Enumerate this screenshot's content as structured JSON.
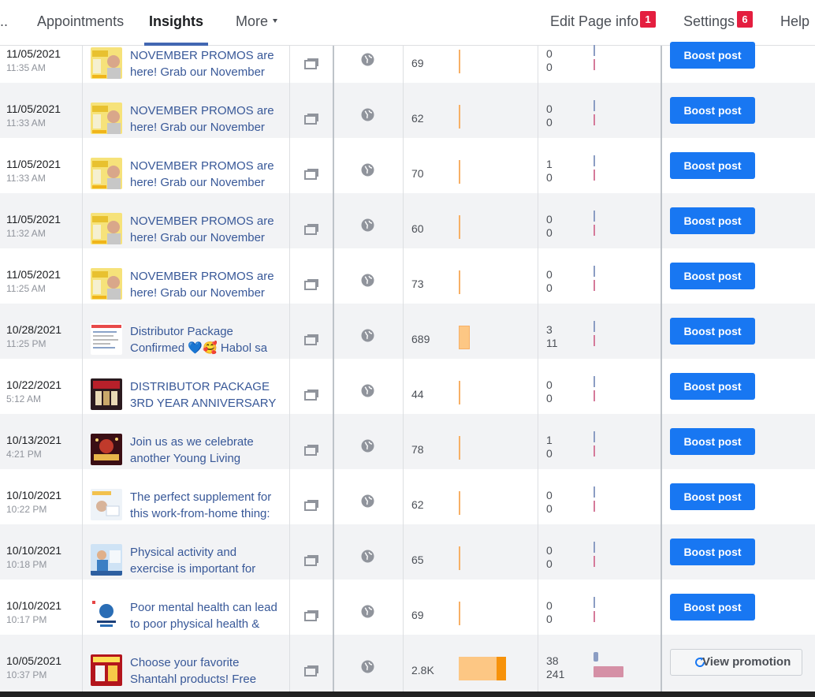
{
  "nav": {
    "leading": "..",
    "appointments": "Appointments",
    "insights": "Insights",
    "more": "More",
    "edit_page_info": "Edit Page info",
    "edit_badge": "1",
    "settings": "Settings",
    "settings_badge": "6",
    "help": "Help"
  },
  "boost_label": "Boost post",
  "view_promotion_label": "View promotion",
  "posts": [
    {
      "date": "11/05/2021",
      "time": "11:35 AM",
      "line1": "NOVEMBER PROMOS are",
      "line2": "here! Grab our November",
      "reach": "69",
      "eng1": "0",
      "eng2": "0",
      "action": "boost",
      "thumb": "promo-yellow"
    },
    {
      "date": "11/05/2021",
      "time": "11:33 AM",
      "line1": "NOVEMBER PROMOS are",
      "line2": "here! Grab our November",
      "reach": "62",
      "eng1": "0",
      "eng2": "0",
      "action": "boost",
      "thumb": "promo-yellow"
    },
    {
      "date": "11/05/2021",
      "time": "11:33 AM",
      "line1": "NOVEMBER PROMOS are",
      "line2": "here! Grab our November",
      "reach": "70",
      "eng1": "1",
      "eng2": "0",
      "action": "boost",
      "thumb": "promo-yellow"
    },
    {
      "date": "11/05/2021",
      "time": "11:32 AM",
      "line1": "NOVEMBER PROMOS are",
      "line2": "here! Grab our November",
      "reach": "60",
      "eng1": "0",
      "eng2": "0",
      "action": "boost",
      "thumb": "promo-yellow"
    },
    {
      "date": "11/05/2021",
      "time": "11:25 AM",
      "line1": "NOVEMBER PROMOS are",
      "line2": "here! Grab our November",
      "reach": "73",
      "eng1": "0",
      "eng2": "0",
      "action": "boost",
      "thumb": "promo-yellow"
    },
    {
      "date": "10/28/2021",
      "time": "11:25 PM",
      "line1": "Distributor Package",
      "line2": "Confirmed 💙🥰 Habol sa",
      "reach": "689",
      "eng1": "3",
      "eng2": "11",
      "action": "boost",
      "thumb": "document"
    },
    {
      "date": "10/22/2021",
      "time": "5:12 AM",
      "line1": "DISTRIBUTOR PACKAGE",
      "line2": "3RD YEAR ANNIVERSARY",
      "reach": "44",
      "eng1": "0",
      "eng2": "0",
      "action": "boost",
      "thumb": "anniversary"
    },
    {
      "date": "10/13/2021",
      "time": "4:21 PM",
      "line1": "Join us as we celebrate",
      "line2": "another Young Living",
      "reach": "78",
      "eng1": "1",
      "eng2": "0",
      "action": "boost",
      "thumb": "celebration"
    },
    {
      "date": "10/10/2021",
      "time": "10:22 PM",
      "line1": "The perfect supplement for",
      "line2": "this work-from-home thing:",
      "reach": "62",
      "eng1": "0",
      "eng2": "0",
      "action": "boost",
      "thumb": "wfh"
    },
    {
      "date": "10/10/2021",
      "time": "10:18 PM",
      "line1": "Physical activity and",
      "line2": "exercise is important for",
      "reach": "65",
      "eng1": "0",
      "eng2": "0",
      "action": "boost",
      "thumb": "exercise"
    },
    {
      "date": "10/10/2021",
      "time": "10:17 PM",
      "line1": "Poor mental health can lead",
      "line2": "to poor physical health &",
      "reach": "69",
      "eng1": "0",
      "eng2": "0",
      "action": "boost",
      "thumb": "mental"
    },
    {
      "date": "10/05/2021",
      "time": "10:37 PM",
      "line1": "Choose your favorite",
      "line2": "Shantahl products! Free",
      "reach": "2.8K",
      "eng1": "38",
      "eng2": "241",
      "action": "view",
      "thumb": "redhot"
    }
  ],
  "bars": {
    "reach_fill": [
      0.03,
      0.03,
      0.03,
      0.03,
      0.03,
      0.34,
      0.03,
      0.03,
      0.03,
      0.03,
      0.03,
      1.0
    ],
    "eng1_fill": [
      0.0,
      0.0,
      0.03,
      0.0,
      0.0,
      0.08,
      0.0,
      0.03,
      0.0,
      0.0,
      0.0,
      1.0
    ],
    "eng2_fill": [
      0.0,
      0.0,
      0.0,
      0.0,
      0.0,
      0.05,
      0.0,
      0.0,
      0.0,
      0.0,
      0.0,
      1.0
    ]
  },
  "colors": {
    "accent": "#1877f2",
    "reach_bar": "#f7923a",
    "eng_bar_a": "#8b9dc3",
    "eng_bar_b": "#d57a9a",
    "link": "#385898",
    "alt_row": "#f2f3f5"
  }
}
